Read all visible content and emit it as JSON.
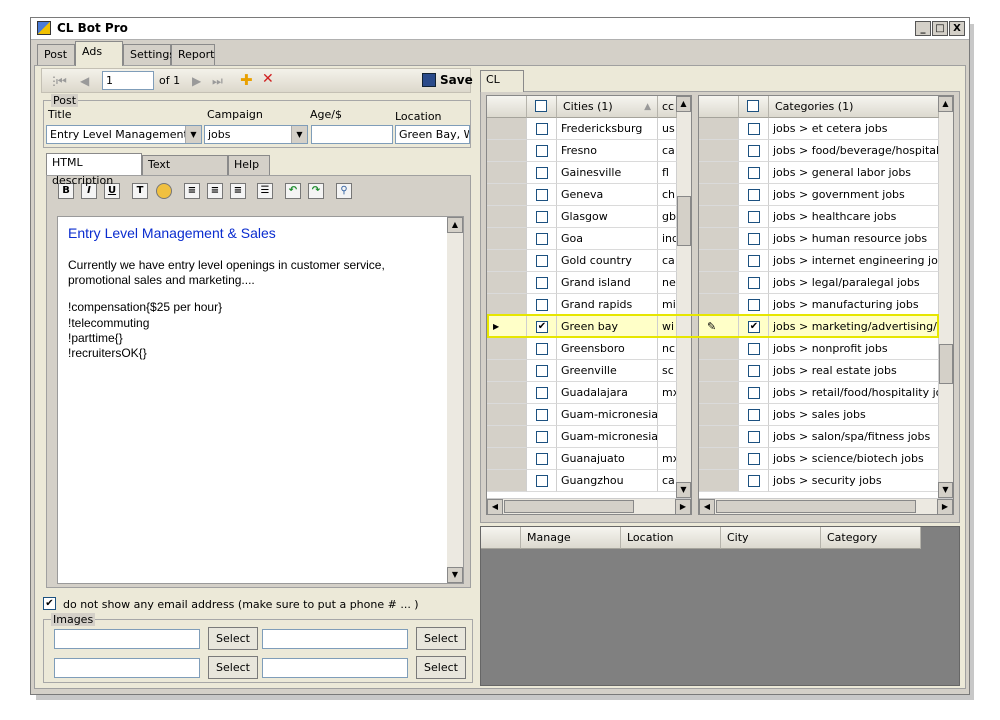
{
  "window": {
    "title": "CL Bot Pro",
    "min": "_",
    "max": "□",
    "close": "X"
  },
  "main_tabs": [
    "Post",
    "Ads",
    "Settings",
    "Report"
  ],
  "toolbar": {
    "page": "1",
    "of_label": "of 1",
    "save_label": "Save"
  },
  "post": {
    "group_label": "Post",
    "title_label": "Title",
    "campaign_label": "Campaign",
    "age_label": "Age/$",
    "location_label": "Location",
    "title_value": "Entry Level Management &",
    "campaign_value": "jobs",
    "age_value": "",
    "location_value": "Green Bay, WI"
  },
  "desc_tabs": [
    "HTML description",
    "Text description",
    "Help"
  ],
  "format_icons": [
    "bold-icon",
    "italic-icon",
    "underline-icon",
    "font-icon",
    "color-palette-icon",
    "align-left-icon",
    "align-center-icon",
    "align-right-icon",
    "list-icon",
    "undo-icon",
    "redo-icon",
    "link-icon"
  ],
  "format_glyphs": {
    "bold": "B",
    "italic": "I",
    "underline": "U",
    "font": "T"
  },
  "editor": {
    "heading": "Entry Level Management & Sales",
    "heading_color": "#0a2ccf",
    "paragraph_1": "Currently we have entry level openings in customer service,",
    "paragraph_2": "promotional sales and marketing....",
    "line_1": "!compensation{$25 per hour}",
    "line_2": "!telecommuting",
    "line_3": "!parttime{}",
    "line_4": "!recruitersOK{}"
  },
  "email_option": {
    "checked": true,
    "label": "do not show any email address (make sure to put a phone # ... )"
  },
  "images": {
    "group_label": "Images",
    "select_label": "Select",
    "fields": [
      "",
      "",
      "",
      ""
    ]
  },
  "cl_tab": "CL",
  "cities": {
    "header": "Cities (1)",
    "header2": "cc",
    "rows": [
      {
        "city": "Fredericksburg",
        "cc": "us",
        "checked": false
      },
      {
        "city": "Fresno",
        "cc": "ca",
        "checked": false
      },
      {
        "city": "Gainesville",
        "cc": "fl",
        "checked": false
      },
      {
        "city": "Geneva",
        "cc": "ch",
        "checked": false
      },
      {
        "city": "Glasgow",
        "cc": "gb",
        "checked": false
      },
      {
        "city": "Goa",
        "cc": "ind",
        "checked": false
      },
      {
        "city": "Gold country",
        "cc": "ca",
        "checked": false
      },
      {
        "city": "Grand island",
        "cc": "ne",
        "checked": false
      },
      {
        "city": "Grand rapids",
        "cc": "mi",
        "checked": false
      },
      {
        "city": "Green bay",
        "cc": "wi",
        "checked": true
      },
      {
        "city": "Greensboro",
        "cc": "nc",
        "checked": false
      },
      {
        "city": "Greenville",
        "cc": "sc",
        "checked": false
      },
      {
        "city": "Guadalajara",
        "cc": "mx",
        "checked": false
      },
      {
        "city": "Guam-micronesia",
        "cc": "",
        "checked": false
      },
      {
        "city": "Guam-micronesia",
        "cc": "",
        "checked": false
      },
      {
        "city": "Guanajuato",
        "cc": "mx",
        "checked": false
      },
      {
        "city": "Guangzhou",
        "cc": "ca",
        "checked": false
      }
    ]
  },
  "categories": {
    "header": "Categories (1)",
    "rows": [
      {
        "label": "jobs > et cetera jobs",
        "checked": false
      },
      {
        "label": "jobs > food/beverage/hospitality jo",
        "checked": false
      },
      {
        "label": "jobs > general labor jobs",
        "checked": false
      },
      {
        "label": "jobs > government jobs",
        "checked": false
      },
      {
        "label": "jobs > healthcare jobs",
        "checked": false
      },
      {
        "label": "jobs > human resource jobs",
        "checked": false
      },
      {
        "label": "jobs > internet engineering jobs",
        "checked": false
      },
      {
        "label": "jobs > legal/paralegal jobs",
        "checked": false
      },
      {
        "label": "jobs > manufacturing jobs",
        "checked": false
      },
      {
        "label": "jobs > marketing/advertising/PR jo",
        "checked": true
      },
      {
        "label": "jobs > nonprofit jobs",
        "checked": false
      },
      {
        "label": "jobs > real estate jobs",
        "checked": false
      },
      {
        "label": "jobs > retail/food/hospitality jobs",
        "checked": false
      },
      {
        "label": "jobs > sales jobs",
        "checked": false
      },
      {
        "label": "jobs > salon/spa/fitness jobs",
        "checked": false
      },
      {
        "label": "jobs > science/biotech jobs",
        "checked": false
      },
      {
        "label": "jobs > security jobs",
        "checked": false
      }
    ]
  },
  "summary": {
    "columns": [
      "Manage",
      "Location",
      "City",
      "Category"
    ]
  }
}
